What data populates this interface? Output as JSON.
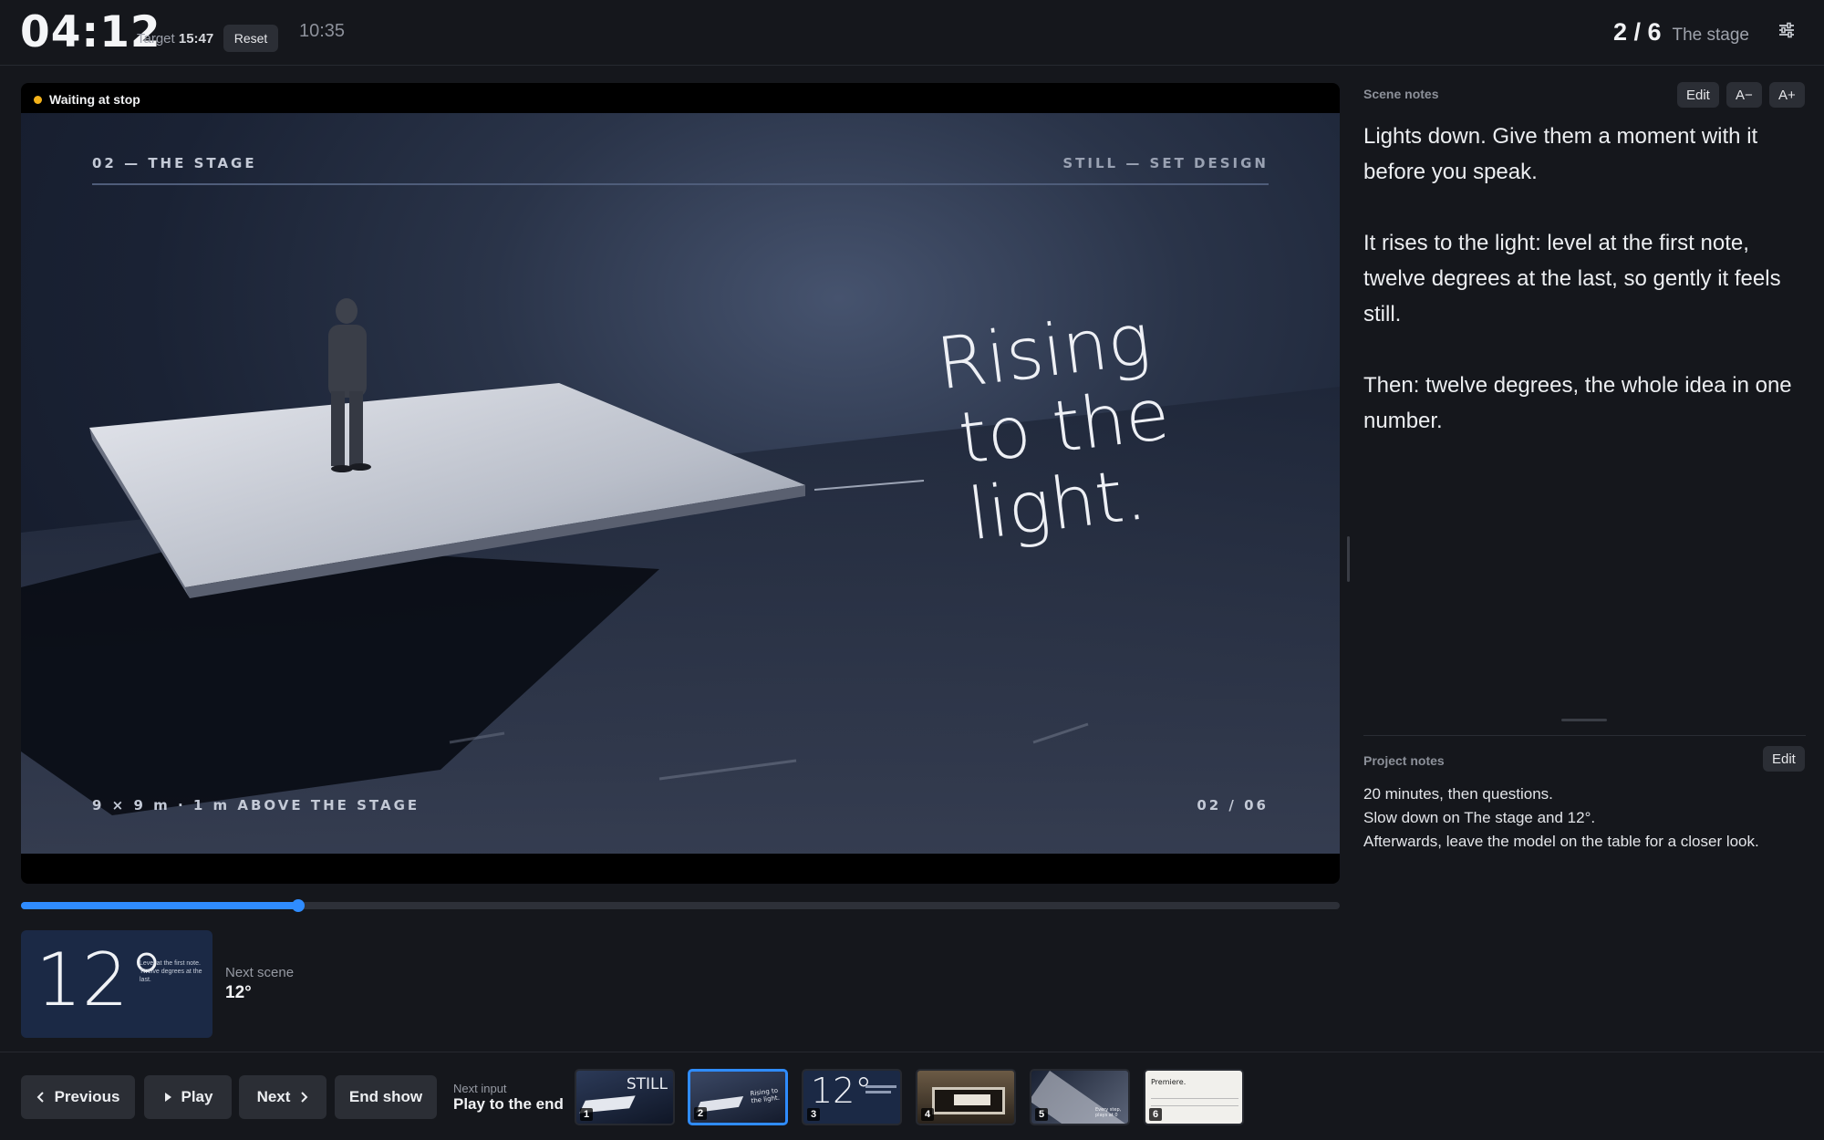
{
  "header": {
    "clock": "04:12",
    "target_label": "Target",
    "target_value": "15:47",
    "reset_label": "Reset",
    "wall_time": "10:35",
    "position": "2 / 6",
    "scene_title": "The stage"
  },
  "stage": {
    "status": "Waiting at stop",
    "slide": {
      "top_left": "02 — THE STAGE",
      "top_right": "STILL — SET DESIGN",
      "headline_line1": "Rising",
      "headline_line2": "to the light.",
      "bottom_left": "9 × 9 m · 1 m ABOVE THE STAGE",
      "bottom_right": "02 / 06"
    }
  },
  "progress": {
    "fraction": 0.21
  },
  "next_scene": {
    "label": "Next scene",
    "title": "12°",
    "thumb_big": "12°",
    "thumb_text": "Level at the first note. Twelve degrees at the last."
  },
  "scene_notes": {
    "label": "Scene notes",
    "edit_label": "Edit",
    "smaller_label": "A−",
    "larger_label": "A+",
    "paragraphs": [
      "Lights down. Give them a moment with it before you speak.",
      "It rises to the light: level at the first note, twelve degrees at the last, so gently it feels still.",
      "Then: twelve degrees, the whole idea in one number."
    ]
  },
  "project_notes": {
    "label": "Project notes",
    "edit_label": "Edit",
    "lines": [
      "20 minutes, then questions.",
      "Slow down on The stage and 12°.",
      "Afterwards, leave the model on the table for a closer look."
    ]
  },
  "controls": {
    "previous": "Previous",
    "play": "Play",
    "next": "Next",
    "end_show": "End show",
    "next_input_label": "Next input",
    "next_input_value": "Play to the end"
  },
  "thumbnails": [
    {
      "num": "1",
      "text": "STILL"
    },
    {
      "num": "2",
      "text": "Rising to the light."
    },
    {
      "num": "3",
      "text": "12°"
    },
    {
      "num": "4",
      "text": ""
    },
    {
      "num": "5",
      "text": "Every step, plays at 0"
    },
    {
      "num": "6",
      "text": "Premiere."
    }
  ],
  "colors": {
    "accent": "#2f8cff",
    "status_dot": "#f3b21a",
    "background": "#15171c",
    "button": "#2b2e35"
  },
  "icons": [
    "settings-sliders-icon",
    "chevron-left-icon",
    "play-icon",
    "chevron-right-icon"
  ]
}
